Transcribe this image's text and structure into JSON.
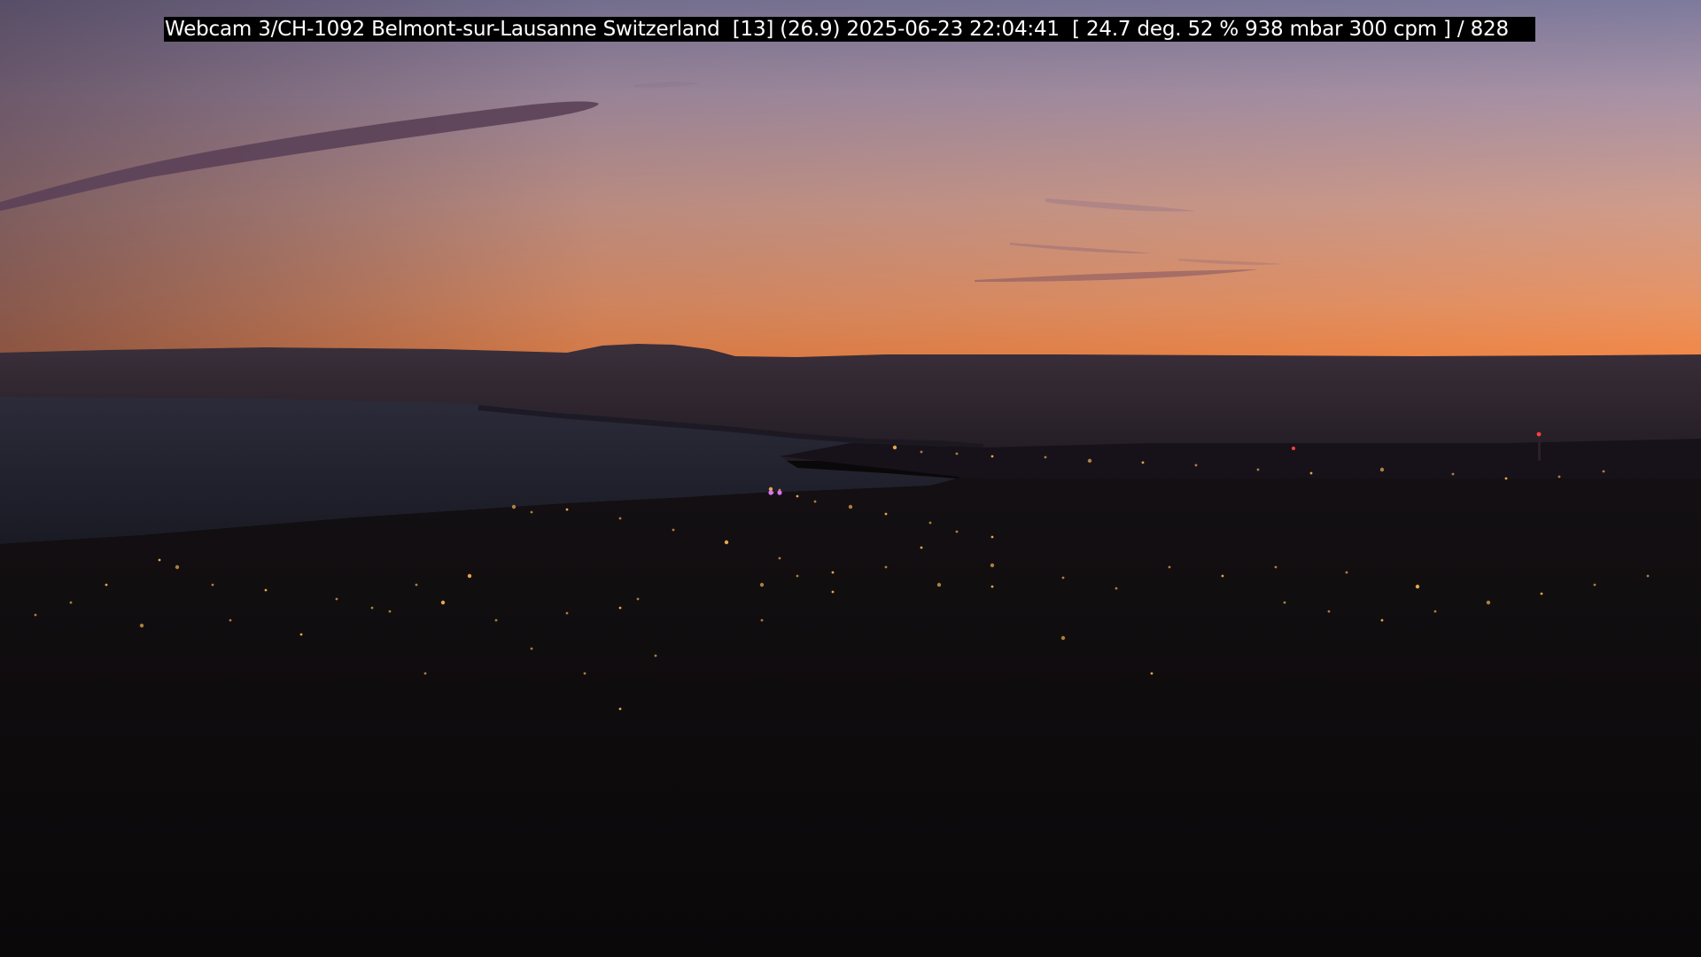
{
  "overlay": {
    "caption": "Webcam 3/CH-1092 Belmont-sur-Lausanne Switzerland  [13] (26.9) 2025-06-23 22:04:41  [ 24.7 deg. 52 % 938 mbar 300 cpm ] / 828"
  },
  "scene": {
    "subject": "dusk view over a lake with distant mountain ridge and town lights",
    "colors": {
      "sky_top": "#8e86a6",
      "sky_mid": "#c79a95",
      "sky_horizon": "#f08a4a",
      "mountains": "#2d2530",
      "lake": "#1f2130",
      "land": "#0d0a0c",
      "cloud": "#5a4156",
      "city_light": "#f0b050"
    }
  }
}
